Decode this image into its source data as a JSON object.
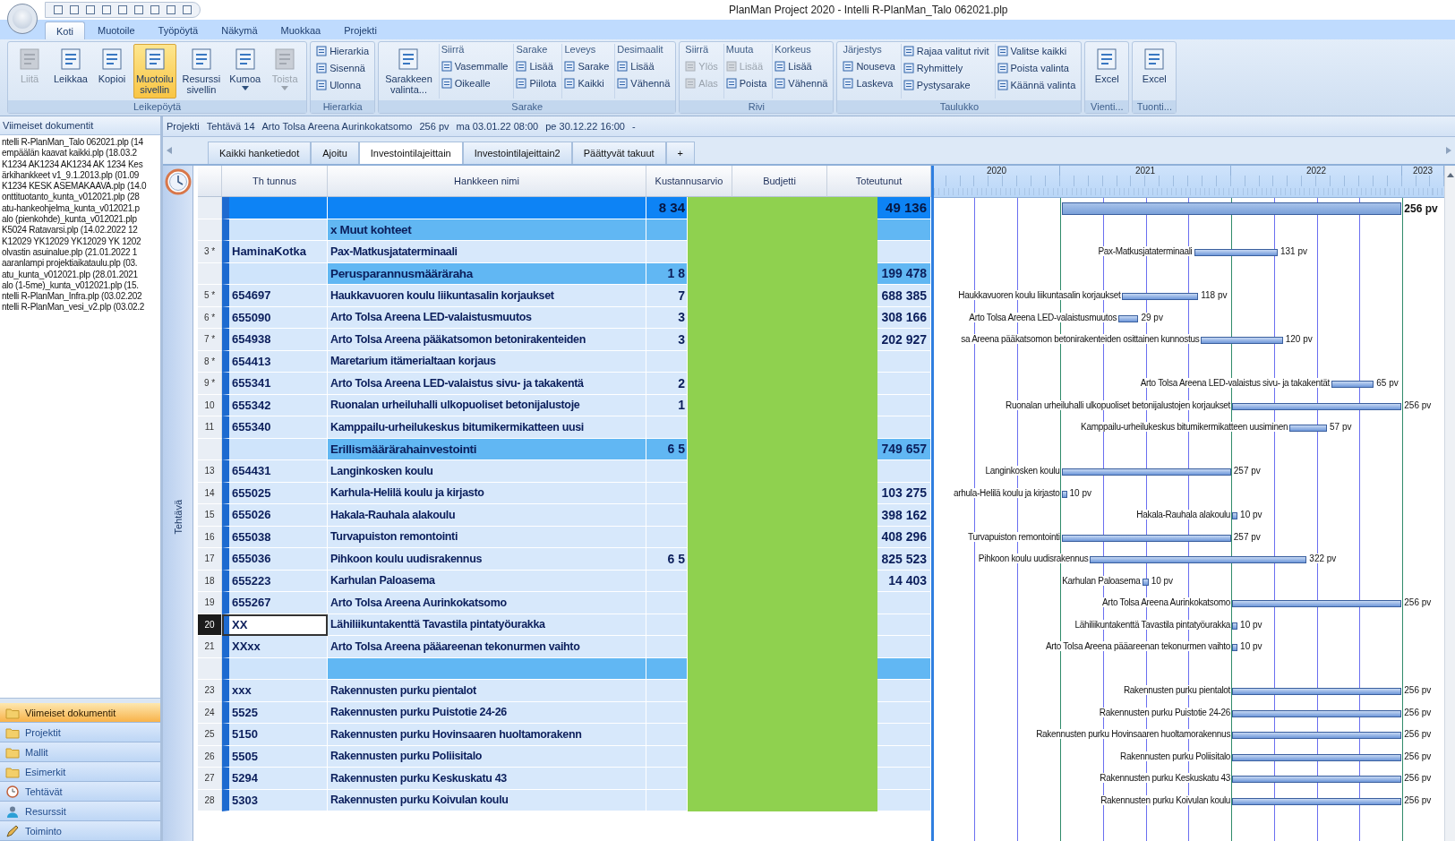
{
  "window": {
    "title": "PlanMan Project 2020 - Intelli R-PlanMan_Talo 062021.plp"
  },
  "menu_tabs": [
    {
      "label": "Koti",
      "selected": true
    },
    {
      "label": "Muotoile",
      "selected": false
    },
    {
      "label": "Työpöytä",
      "selected": false
    },
    {
      "label": "Näkymä",
      "selected": false
    },
    {
      "label": "Muokkaa",
      "selected": false
    },
    {
      "label": "Projekti",
      "selected": false
    }
  ],
  "ribbon": {
    "groups": [
      {
        "label": "Leikepöytä",
        "items": [
          {
            "kind": "large",
            "label": "Liitä",
            "disabled": true,
            "highlighted": false,
            "dropdown": false
          },
          {
            "kind": "large",
            "label": "Leikkaa",
            "disabled": false,
            "highlighted": false,
            "dropdown": false
          },
          {
            "kind": "large",
            "label": "Kopioi",
            "disabled": false,
            "highlighted": false,
            "dropdown": false
          },
          {
            "kind": "large",
            "label": "Muotoilu sivellin",
            "disabled": false,
            "highlighted": true,
            "dropdown": false
          },
          {
            "kind": "large",
            "label": "Resurssi sivellin",
            "disabled": false,
            "highlighted": false,
            "dropdown": false
          },
          {
            "kind": "large",
            "label": "Kumoa",
            "disabled": false,
            "highlighted": false,
            "dropdown": true
          },
          {
            "kind": "large",
            "label": "Toista",
            "disabled": true,
            "highlighted": false,
            "dropdown": true
          }
        ]
      },
      {
        "label": "Hierarkia",
        "items": [
          {
            "kind": "column",
            "buttons": [
              {
                "label": "Hierarkia",
                "disabled": false
              },
              {
                "label": "Sisennä",
                "disabled": false
              },
              {
                "label": "Ulonna",
                "disabled": false
              }
            ]
          }
        ]
      },
      {
        "label": "Sarake",
        "items": [
          {
            "kind": "large",
            "label": "Sarakkeen valinta...",
            "disabled": false,
            "highlighted": false,
            "dropdown": false
          },
          {
            "kind": "column",
            "heading": "Siirrä",
            "buttons": [
              {
                "label": "Vasemmalle",
                "disabled": false
              },
              {
                "label": "Oikealle",
                "disabled": false
              }
            ]
          },
          {
            "kind": "column",
            "heading": "Sarake",
            "buttons": [
              {
                "label": "Lisää",
                "disabled": false
              },
              {
                "label": "Piilota",
                "disabled": false
              }
            ]
          },
          {
            "kind": "column",
            "heading": "Leveys",
            "buttons": [
              {
                "label": "Sarake",
                "disabled": false
              },
              {
                "label": "Kaikki",
                "disabled": false
              }
            ]
          },
          {
            "kind": "column",
            "heading": "Desimaalit",
            "buttons": [
              {
                "label": "Lisää",
                "disabled": false
              },
              {
                "label": "Vähennä",
                "disabled": false
              }
            ]
          }
        ]
      },
      {
        "label": "Rivi",
        "items": [
          {
            "kind": "column",
            "heading": "Siirrä",
            "buttons": [
              {
                "label": "Ylös",
                "disabled": true
              },
              {
                "label": "Alas",
                "disabled": true
              }
            ]
          },
          {
            "kind": "column",
            "heading": "Muuta",
            "buttons": [
              {
                "label": "Lisää",
                "disabled": true
              },
              {
                "label": "Poista",
                "disabled": false
              }
            ]
          },
          {
            "kind": "column",
            "heading": "Korkeus",
            "buttons": [
              {
                "label": "Lisää",
                "disabled": false
              },
              {
                "label": "Vähennä",
                "disabled": false
              }
            ]
          }
        ]
      },
      {
        "label": "Taulukko",
        "items": [
          {
            "kind": "column",
            "heading": "Järjestys",
            "buttons": [
              {
                "label": "Nouseva",
                "disabled": false
              },
              {
                "label": "Laskeva",
                "disabled": false
              }
            ]
          },
          {
            "kind": "column",
            "buttons": [
              {
                "label": "Rajaa valitut rivit",
                "disabled": false
              },
              {
                "label": "Ryhmittely",
                "disabled": false
              },
              {
                "label": "Pystysarake",
                "disabled": false
              }
            ]
          },
          {
            "kind": "column",
            "buttons": [
              {
                "label": "Valitse kaikki",
                "disabled": false
              },
              {
                "label": "Poista valinta",
                "disabled": false
              },
              {
                "label": "Käännä valinta",
                "disabled": false
              }
            ]
          }
        ]
      },
      {
        "label": "Vienti...",
        "items": [
          {
            "kind": "large",
            "label": "Excel",
            "disabled": false,
            "highlighted": false,
            "dropdown": false
          }
        ]
      },
      {
        "label": "Tuonti...",
        "items": [
          {
            "kind": "large",
            "label": "Excel",
            "disabled": false,
            "highlighted": false,
            "dropdown": false
          }
        ]
      }
    ]
  },
  "recent_documents": {
    "title": "Viimeiset dokumentit",
    "items": [
      "ntelli R-PlanMan_Talo 062021.plp (14",
      "empäälän kaavat kaikki.plp (18.03.2",
      "K1234 AK1234 AK1234 AK 1234 Kes",
      "ärkihankkeet v1_9.1.2013.plp (01.09",
      "K1234 KESK ASEMAKAAVA.plp (14.0",
      "onttituotanto_kunta_v012021.plp (28",
      "atu-hankeohjelma_kunta_v012021.p",
      "alo (pienkohde)_kunta_v012021.plp",
      "K5024 Ratavarsi.plp (14.02.2022 12",
      "K12029 YK12029 YK12029 YK 1202",
      "olvastin asuinalue.plp (21.01.2022 1",
      "aaranlampi projektiaikataulu.plp (03.",
      "atu_kunta_v012021.plp (28.01.2021",
      "alo (1-5me)_kunta_v012021.plp (15.",
      "ntelli R-PlanMan_Infra.plp (03.02.202",
      "ntelli R-PlanMan_vesi_v2.plp (03.02.2"
    ]
  },
  "navigation": [
    {
      "label": "Viimeiset dokumentit",
      "kind": "folder",
      "selected": true
    },
    {
      "label": "Projektit",
      "kind": "folder",
      "selected": false
    },
    {
      "label": "Mallit",
      "kind": "folder",
      "selected": false
    },
    {
      "label": "Esimerkit",
      "kind": "folder",
      "selected": false
    },
    {
      "label": "Tehtävät",
      "kind": "tasks",
      "selected": false
    },
    {
      "label": "Resurssit",
      "kind": "resources",
      "selected": false
    },
    {
      "label": "Toiminto",
      "kind": "action",
      "selected": false
    }
  ],
  "info_bar": [
    "Projekti",
    "Tehtävä 14",
    "Arto Tolsa Areena Aurinkokatsomo",
    "256 pv",
    "ma 03.01.22 08:00",
    "pe 30.12.22 16:00",
    "-"
  ],
  "view_tabs": [
    {
      "label": "Kaikki hanketiedot",
      "selected": false
    },
    {
      "label": "Ajoitu",
      "selected": false
    },
    {
      "label": "Investointilajeittain",
      "selected": true
    },
    {
      "label": "Investointilajeittain2",
      "selected": false
    },
    {
      "label": "Päättyvät takuut",
      "selected": false
    },
    {
      "label": "+",
      "selected": false
    }
  ],
  "side_strip": {
    "label": "Tehtävä"
  },
  "table": {
    "columns": [
      "Th tunnus",
      "Hankkeen nimi",
      "Kustannusarvio",
      "Budjetti",
      "Toteutunut"
    ],
    "rows": [
      {
        "kind": "summary",
        "selected": false,
        "cost": "8 34",
        "actual": "49 136",
        "gantt": {
          "duration": "256 pv"
        }
      },
      {
        "kind": "group",
        "selected": false,
        "name": "x Muut kohteet"
      },
      {
        "kind": "task",
        "selected": false,
        "number": "3 *",
        "code": "HaminaKotka",
        "name": "Pax-Matkusjataterminaali",
        "gantt": {
          "label": "Pax-Matkusjataterminaali",
          "duration": "131 pv"
        }
      },
      {
        "kind": "group",
        "selected": false,
        "name": "Perusparannusmääräraha",
        "cost": "1 8",
        "actual": "199 478"
      },
      {
        "kind": "task",
        "selected": false,
        "number": "5 *",
        "code": "654697",
        "name": "Haukkavuoren koulu liikuntasalin korjaukset",
        "cost": "7",
        "actual": "688 385",
        "gantt": {
          "label": "Haukkavuoren koulu liikuntasalin korjaukset",
          "duration": "118 pv"
        }
      },
      {
        "kind": "task",
        "selected": false,
        "number": "6 *",
        "code": "655090",
        "name": "Arto Tolsa Areena LED-valaistusmuutos",
        "cost": "3",
        "actual": "308 166",
        "gantt": {
          "label": "Arto Tolsa Areena LED-valaistusmuutos",
          "duration": "29 pv"
        }
      },
      {
        "kind": "task",
        "selected": false,
        "number": "7 *",
        "code": "654938",
        "name": "Arto Tolsa Areena pääkatsomon betonirakenteiden",
        "cost": "3",
        "actual": "202 927",
        "gantt": {
          "label": "sa Areena pääkatsomon betonirakenteiden osittainen kunnostus",
          "duration": "120 pv"
        }
      },
      {
        "kind": "task",
        "selected": false,
        "number": "8 *",
        "code": "654413",
        "name": "Maretarium itämerialtaan korjaus"
      },
      {
        "kind": "task",
        "selected": false,
        "number": "9 *",
        "code": "655341",
        "name": "Arto Tolsa Areena LED-valaistus sivu- ja takakentä",
        "cost": "2",
        "gantt": {
          "label": "Arto Tolsa Areena LED-valaistus sivu- ja takakentät",
          "duration": "65 pv"
        }
      },
      {
        "kind": "task",
        "selected": false,
        "number": "10",
        "code": "655342",
        "name": "Ruonalan urheiluhalli ulkopuoliset betonijalustoje",
        "cost": "1",
        "gantt": {
          "label": "Ruonalan urheiluhalli ulkopuoliset betonijalustojen korjaukset",
          "duration": "256 pv"
        }
      },
      {
        "kind": "task",
        "selected": false,
        "number": "11",
        "code": "655340",
        "name": "Kamppailu-urheilukeskus bitumikermikatteen uusi",
        "gantt": {
          "label": "Kamppailu-urheilukeskus bitumikermikatteen uusiminen",
          "duration": "57 pv"
        }
      },
      {
        "kind": "group",
        "selected": false,
        "name": "Erillismäärärahainvestointi",
        "cost": "6 5",
        "actual": "749 657"
      },
      {
        "kind": "task",
        "selected": false,
        "number": "13",
        "code": "654431",
        "name": "Langinkosken koulu",
        "gantt": {
          "label": "Langinkosken koulu",
          "duration": "257 pv"
        }
      },
      {
        "kind": "task",
        "selected": false,
        "number": "14",
        "code": "655025",
        "name": "Karhula-Helilä koulu ja kirjasto",
        "actual": "103 275",
        "gantt": {
          "label": "arhula-Helilä koulu ja kirjasto",
          "duration": "10 pv"
        }
      },
      {
        "kind": "task",
        "selected": false,
        "number": "15",
        "code": "655026",
        "name": "Hakala-Rauhala alakoulu",
        "actual": "398 162",
        "gantt": {
          "label": "Hakala-Rauhala alakoulu",
          "duration": "10 pv"
        }
      },
      {
        "kind": "task",
        "selected": false,
        "number": "16",
        "code": "655038",
        "name": "Turvapuiston remontointi",
        "actual": "408 296",
        "gantt": {
          "label": "Turvapuiston remontointi",
          "duration": "257 pv"
        }
      },
      {
        "kind": "task",
        "selected": false,
        "number": "17",
        "code": "655036",
        "name": "Pihkoon koulu uudisrakennus",
        "cost": "6 5",
        "actual": "825 523",
        "gantt": {
          "label": "Pihkoon koulu uudisrakennus",
          "duration": "322 pv"
        }
      },
      {
        "kind": "task",
        "selected": false,
        "number": "18",
        "code": "655223",
        "name": "Karhulan Paloasema",
        "actual": "14 403",
        "gantt": {
          "label": "Karhulan Paloasema",
          "duration": "10 pv"
        }
      },
      {
        "kind": "task",
        "selected": false,
        "number": "19",
        "code": "655267",
        "name": "Arto Tolsa Areena Aurinkokatsomo",
        "gantt": {
          "label": "Arto Tolsa Areena Aurinkokatsomo",
          "duration": "256 pv"
        }
      },
      {
        "kind": "task",
        "selected": true,
        "number": "20",
        "code": "XX",
        "name": "Lähiliikuntakenttä Tavastila pintatyöurakka",
        "gantt": {
          "label": "Lähiliikuntakenttä Tavastila pintatyöurakka",
          "duration": "10 pv"
        }
      },
      {
        "kind": "task",
        "selected": false,
        "number": "21",
        "code": "XXxx",
        "name": "Arto Tolsa Areena pääareenan tekonurmen vaihto",
        "gantt": {
          "label": "Arto Tolsa Areena pääareenan tekonurmen vaihto",
          "duration": "10 pv"
        }
      },
      {
        "kind": "group",
        "selected": false
      },
      {
        "kind": "task",
        "selected": false,
        "number": "23",
        "code": "xxx",
        "name": "Rakennusten purku pientalot",
        "gantt": {
          "label": "Rakennusten purku pientalot",
          "duration": "256 pv"
        }
      },
      {
        "kind": "task",
        "selected": false,
        "number": "24",
        "code": "5525",
        "name": "Rakennusten purku Puistotie 24-26",
        "gantt": {
          "label": "Rakennusten purku Puistotie 24-26",
          "duration": "256 pv"
        }
      },
      {
        "kind": "task",
        "selected": false,
        "number": "25",
        "code": "5150",
        "name": "Rakennusten purku Hovinsaaren huoltamorakenn",
        "gantt": {
          "label": "Rakennusten purku Hovinsaaren huoltamorakennus",
          "duration": "256 pv"
        }
      },
      {
        "kind": "task",
        "selected": false,
        "number": "26",
        "code": "5505",
        "name": "Rakennusten purku Poliisitalo",
        "gantt": {
          "label": "Rakennusten purku Poliisitalo",
          "duration": "256 pv"
        }
      },
      {
        "kind": "task",
        "selected": false,
        "number": "27",
        "code": "5294",
        "name": "Rakennusten purku Keskuskatu 43",
        "gantt": {
          "label": "Rakennusten purku Keskuskatu 43",
          "duration": "256 pv"
        }
      },
      {
        "kind": "task",
        "selected": false,
        "number": "28",
        "code": "5303",
        "name": "Rakennusten purku Koivulan koulu",
        "gantt": {
          "label": "Rakennusten purku Koivulan koulu",
          "duration": "256 pv"
        }
      }
    ]
  },
  "timeline": {
    "years": [
      "2020",
      "2021",
      "2022",
      "2023"
    ]
  }
}
